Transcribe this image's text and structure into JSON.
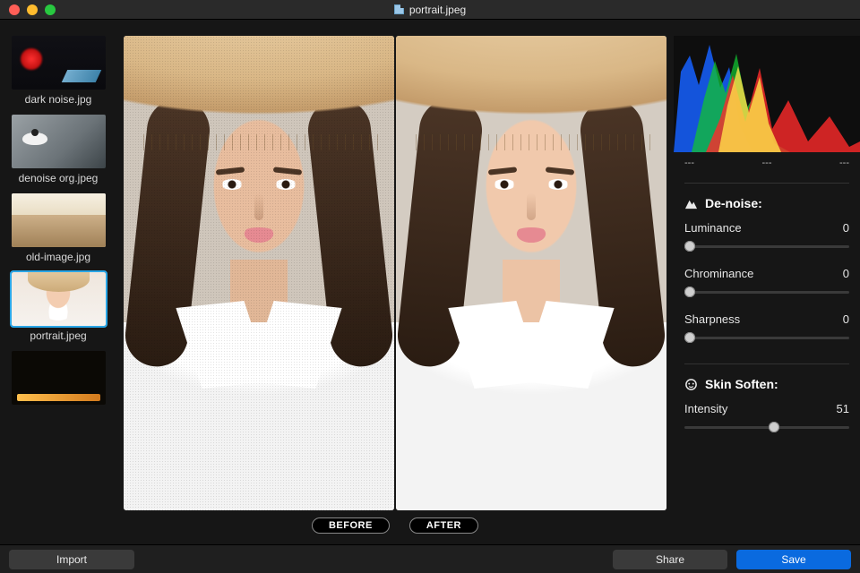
{
  "titlebar": {
    "filename": "portrait.jpeg"
  },
  "sidebar": {
    "items": [
      {
        "label": "dark noise.jpg"
      },
      {
        "label": "denoise org.jpeg"
      },
      {
        "label": "old-image.jpg"
      },
      {
        "label": "portrait.jpeg"
      },
      {
        "label": ""
      }
    ],
    "selected_index": 3
  },
  "compare": {
    "before_label": "BEFORE",
    "after_label": "AFTER"
  },
  "histogram": {
    "readouts": [
      "---",
      "---",
      "---"
    ]
  },
  "panel": {
    "denoise": {
      "title": "De-noise:",
      "controls": [
        {
          "label": "Luminance",
          "value": 0
        },
        {
          "label": "Chrominance",
          "value": 0
        },
        {
          "label": "Sharpness",
          "value": 0
        }
      ]
    },
    "skin": {
      "title": "Skin Soften:",
      "controls": [
        {
          "label": "Intensity",
          "value": 51
        }
      ]
    }
  },
  "footer": {
    "import": "Import",
    "share": "Share",
    "save": "Save"
  }
}
